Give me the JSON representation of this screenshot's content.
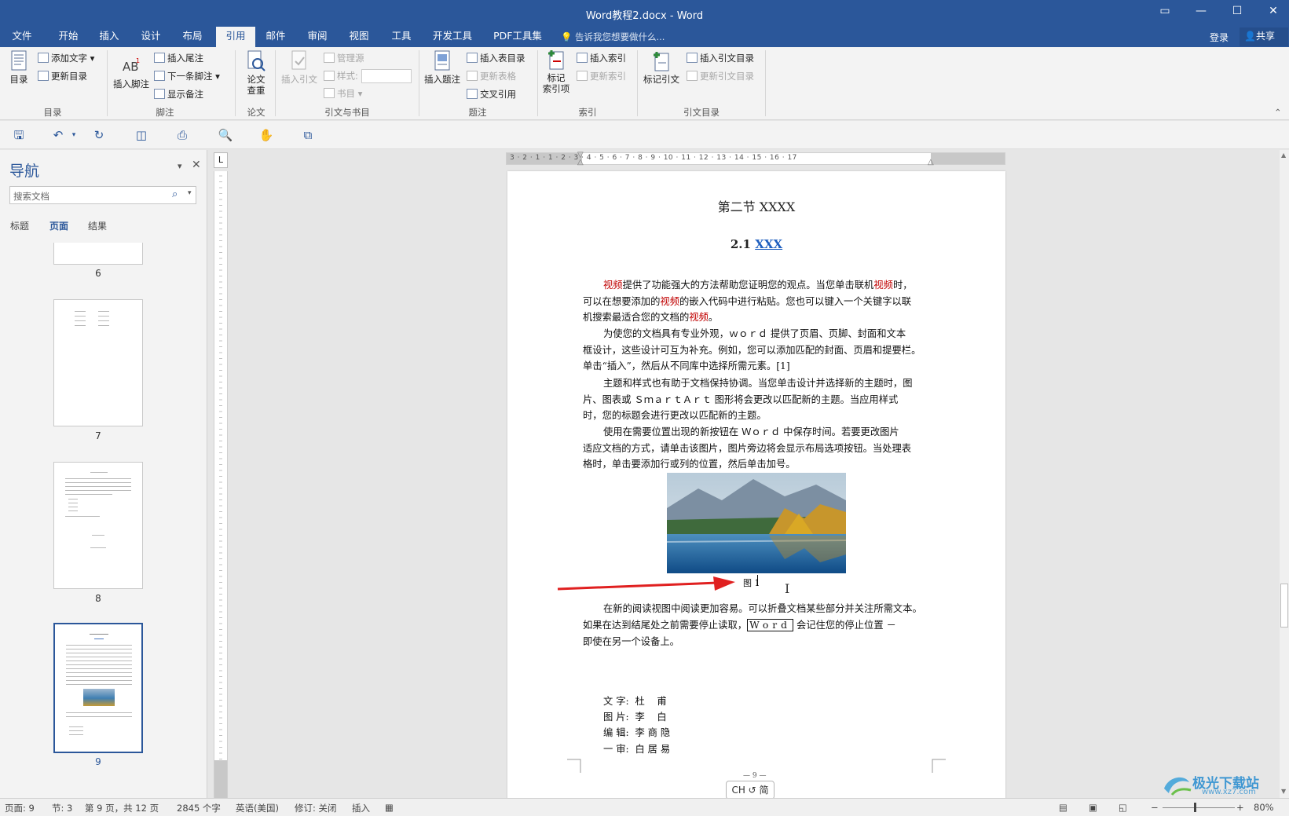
{
  "window": {
    "title": "Word教程2.docx - Word"
  },
  "tabs": [
    "文件",
    "开始",
    "插入",
    "设计",
    "布局",
    "引用",
    "邮件",
    "审阅",
    "视图",
    "工具",
    "开发工具",
    "PDF工具集"
  ],
  "tellme": "告诉我您想要做什么...",
  "account": {
    "login": "登录",
    "share": "共享"
  },
  "ribbon": {
    "toc": {
      "big": "目录",
      "add_text": "添加文字",
      "update": "更新目录",
      "group": "目录"
    },
    "footnote": {
      "big": "插入脚注",
      "endnote": "插入尾注",
      "next": "下一条脚注",
      "show": "显示备注",
      "group": "脚注"
    },
    "thesis": {
      "big1": "论文",
      "big2": "查重",
      "group": "论文"
    },
    "citation": {
      "big": "插入引文",
      "manage": "管理源",
      "style": "样式:",
      "biblio": "书目",
      "group": "引文与书目"
    },
    "caption": {
      "big": "插入题注",
      "insert_table": "插入表目录",
      "update_table": "更新表格",
      "cross": "交叉引用",
      "group": "题注"
    },
    "index": {
      "big1": "标记",
      "big2": "索引项",
      "insert": "插入索引",
      "update": "更新索引",
      "group": "索引"
    },
    "authorities": {
      "big": "标记引文",
      "insert": "插入引文目录",
      "update": "更新引文目录",
      "group": "引文目录"
    }
  },
  "nav": {
    "title": "导航",
    "search_placeholder": "搜索文档",
    "tabs": [
      "标题",
      "页面",
      "结果"
    ],
    "pages": [
      "6",
      "7",
      "8",
      "9"
    ]
  },
  "ruler": {
    "h_ticks": "3 · 2 · 1 · 1 · 2 · 3 · 4 · 5 · 6 · 7 · 8 · 9 · 10 · 11 · 12 · 13 · 14 · 15 · 16 · 17",
    "corner": "L"
  },
  "document": {
    "section": "第二节  XXXX",
    "heading_num": "2.1",
    "heading_link": "XXX",
    "p1": [
      [
        "视频",
        "提供了功能强大的方法帮助您证明您的观点。当您单击联机",
        "视频",
        "时，"
      ],
      [
        "可以在想要添加的",
        "视频",
        "的嵌入代码中进行粘贴。您也可以键入一个关键字以联"
      ],
      [
        "机搜索最适合您的文档的",
        "视频",
        "。"
      ]
    ],
    "p2": [
      "为使您的文档具有专业外观，ｗｏｒｄ 提供了页眉、页脚、封面和文本",
      "框设计，这些设计可互为补充。例如，您可以添加匹配的封面、页眉和提要栏。",
      "单击“插入”，然后从不同库中选择所需元素。[1]"
    ],
    "p3": [
      "主题和样式也有助于文档保持协调。当您单击设计并选择新的主题时，图",
      "片、图表或 ＳｍａｒｔＡｒｔ 图形将会更改以匹配新的主题。当应用样式",
      "时，您的标题会进行更改以匹配新的主题。"
    ],
    "p4": [
      "使用在需要位置出现的新按钮在 Ｗｏｒｄ 中保存时间。若要更改图片",
      "适应文档的方式，请单击该图片，图片旁边将会显示布局选项按钮。当处理表",
      "格时，单击要添加行或列的位置，然后单击加号。"
    ],
    "caption": "图 1",
    "p5a": "在新的阅读视图中阅读更加容易。可以折叠文档某些部分并关注所需文本。",
    "p5b_pre": "如果在达到结尾处之前需要停止读取，",
    "p5b_box": "Word",
    "p5b_post": " 会记住您的停止位置 －",
    "p5c": "即使在另一个设备上。",
    "credits": [
      "文 字:  杜    甫",
      "图 片:  李    白",
      "编 辑:  李 商 隐",
      "一 审:  白 居 易"
    ],
    "footer": "— 9 —"
  },
  "ime": "CH ↺ 简",
  "status": {
    "page": "页面: 9",
    "section": "节: 3",
    "pageof": "第 9 页，共 12 页",
    "words": "2845 个字",
    "lang": "英语(美国)",
    "track": "修订: 关闭",
    "insert": "插入",
    "zoom": "80%"
  },
  "watermark": {
    "text1": "极光下载站",
    "text2": "www.xz7.com"
  },
  "colors": {
    "brand": "#2b579a",
    "link": "#1f5fbf",
    "highlight": "#c00000",
    "arrow": "#e02020"
  }
}
